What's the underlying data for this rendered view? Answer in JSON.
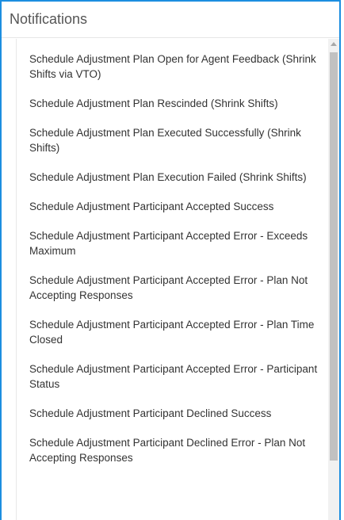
{
  "panel": {
    "title": "Notifications"
  },
  "notifications": [
    "Schedule Adjustment Plan Open for Agent Feedback (Shrink Shifts via VTO)",
    "Schedule Adjustment Plan Rescinded (Shrink Shifts)",
    "Schedule Adjustment Plan Executed Successfully (Shrink Shifts)",
    "Schedule Adjustment Plan Execution Failed (Shrink Shifts)",
    "Schedule Adjustment Participant Accepted Success",
    "Schedule Adjustment Participant Accepted Error - Exceeds Maximum",
    "Schedule Adjustment Participant Accepted Error - Plan Not Accepting Responses",
    "Schedule Adjustment Participant Accepted Error - Plan Time Closed",
    "Schedule Adjustment Participant Accepted Error - Participant Status",
    "Schedule Adjustment Participant Declined Success",
    "Schedule Adjustment Participant Declined Error - Plan Not Accepting Responses"
  ]
}
